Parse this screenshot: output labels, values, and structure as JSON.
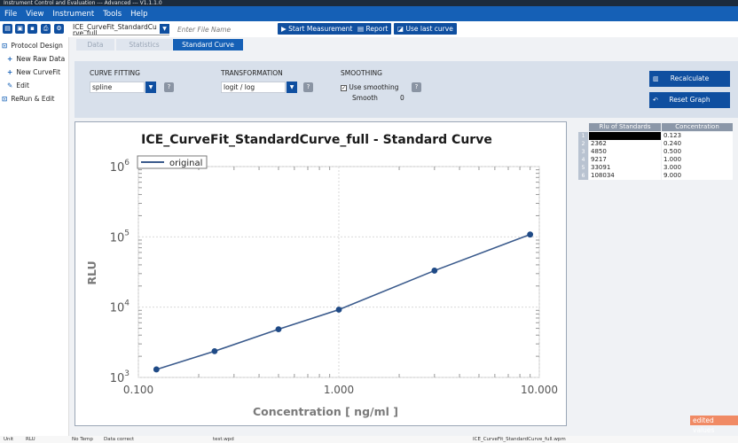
{
  "window": {
    "title": "Instrument Control and Evaluation --- Advanced --- V1.1.1.0"
  },
  "menu": [
    "File",
    "View",
    "Instrument",
    "Tools",
    "Help"
  ],
  "toolbar": {
    "file_combo_value": "ICE_CurveFit_StandardCurve_full",
    "filename_placeholder": "Enter File Name",
    "start_measurement_label": "Start Measurement",
    "report_label": "Report",
    "use_last_curve_label": "Use last curve"
  },
  "sidebar": {
    "items": [
      {
        "label": "Protocol Design",
        "icon": "protocol-icon"
      },
      {
        "label": "New Raw Data",
        "icon": "plus-icon"
      },
      {
        "label": "New CurveFit",
        "icon": "plus-icon"
      },
      {
        "label": "Edit",
        "icon": "edit-icon"
      },
      {
        "label": "ReRun & Edit",
        "icon": "rerun-icon"
      }
    ]
  },
  "tabs": [
    {
      "label": "Data",
      "active": false
    },
    {
      "label": "Statistics",
      "active": false
    },
    {
      "label": "Standard Curve",
      "active": true
    }
  ],
  "controls": {
    "curve_fitting_label": "CURVE FITTING",
    "curve_fitting_value": "spline",
    "transformation_label": "TRANSFORMATION",
    "transformation_value": "logit / log",
    "smoothing_label": "SMOOTHING",
    "use_smoothing_label": "Use smoothing",
    "use_smoothing_checked": true,
    "smooth_label": "Smooth",
    "smooth_value": "0",
    "recalculate_label": "Recalculate",
    "reset_graph_label": "Reset Graph"
  },
  "table": {
    "headers": [
      "Rlu of Standards",
      "Concentration"
    ],
    "rows": [
      {
        "index": "1",
        "rlu": "",
        "conc": "0.123",
        "selected": true
      },
      {
        "index": "2",
        "rlu": "2362",
        "conc": "0.240",
        "selected": false
      },
      {
        "index": "3",
        "rlu": "4850",
        "conc": "0.500",
        "selected": false
      },
      {
        "index": "4",
        "rlu": "9217",
        "conc": "1.000",
        "selected": false
      },
      {
        "index": "5",
        "rlu": "33091",
        "conc": "3.000",
        "selected": false
      },
      {
        "index": "6",
        "rlu": "108034",
        "conc": "9.000",
        "selected": false
      }
    ]
  },
  "edited_badge": "edited values",
  "status": {
    "unit_label": "Unit",
    "rlu_label": "RLU",
    "temp": "No Temp",
    "data": "Data correct",
    "file": "test.wpd",
    "curve_file": "ICE_CurveFit_StandardCurve_full.wpm"
  },
  "chart_data": {
    "type": "line",
    "title": "ICE_CurveFit_StandardCurve_full - Standard Curve",
    "xlabel": "Concentration [ ng/ml ]",
    "ylabel": "RLU",
    "x_scale": "log",
    "y_scale": "log",
    "xlim": [
      0.1,
      10
    ],
    "ylim": [
      1000,
      1000000
    ],
    "x_ticks": [
      "0.100",
      "1.000",
      "10.000"
    ],
    "y_ticks": [
      3,
      4,
      5,
      6
    ],
    "grid": true,
    "legend_position": "top-left",
    "series": [
      {
        "name": "original",
        "color": "#3a5a8c",
        "x": [
          0.123,
          0.24,
          0.5,
          1.0,
          3.0,
          9.0
        ],
        "y": [
          1300,
          2362,
          4850,
          9217,
          33091,
          108034
        ]
      }
    ]
  }
}
